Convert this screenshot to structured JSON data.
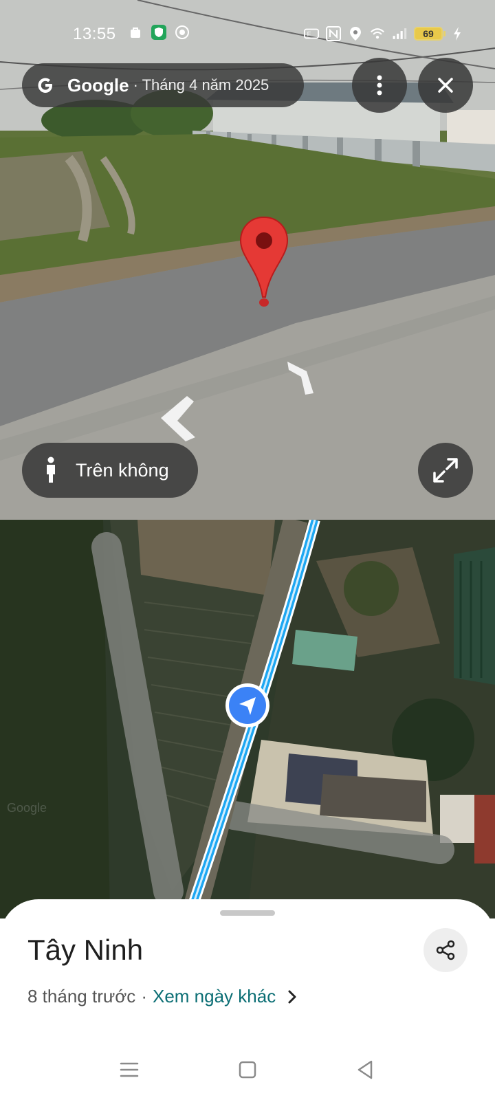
{
  "status_bar": {
    "time": "13:55",
    "battery": "69",
    "icons": [
      "bag-icon",
      "shield-icon",
      "vpn-icon",
      "nfc-icon",
      "n-icon",
      "location-icon",
      "wifi-icon",
      "signal-icon",
      "battery-icon",
      "charging-icon"
    ]
  },
  "street_view": {
    "brand": "Google",
    "date": "· Tháng 4 năm 2025",
    "aerial_label": "Trên không",
    "buttons": [
      "more-options-icon",
      "close-icon",
      "expand-icon"
    ]
  },
  "place": {
    "title": "Tây Ninh",
    "age": "8 tháng trước",
    "separator": "·",
    "other_dates_link": "Xem ngày khác"
  },
  "colors": {
    "chip_bg": "#373737",
    "pin_red": "#e53935",
    "route_blue": "#1ea7f2",
    "locator_blue": "#3b82f6",
    "link_teal": "#0b6e74"
  }
}
